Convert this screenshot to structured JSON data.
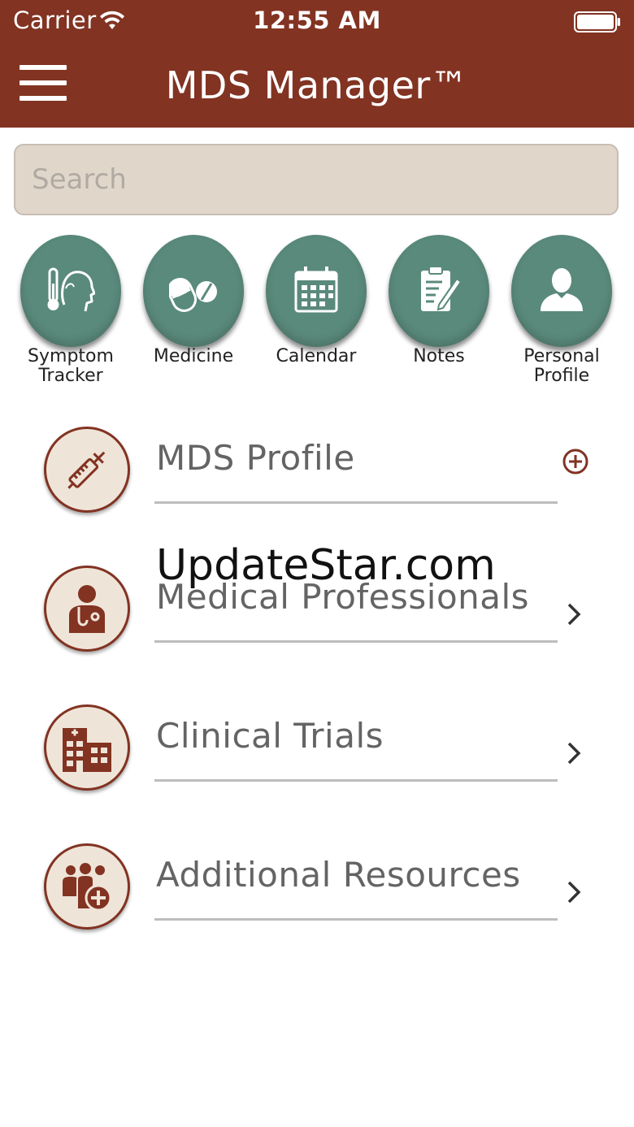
{
  "status_bar": {
    "carrier": "Carrier",
    "time": "12:55 AM"
  },
  "header": {
    "title": "MDS Manager™",
    "background_color": "#823322"
  },
  "search": {
    "placeholder": "Search",
    "value": ""
  },
  "quick_actions": [
    {
      "label": "Symptom\nTracker",
      "icon": "symptom-tracker-icon"
    },
    {
      "label": "Medicine",
      "icon": "pills-icon"
    },
    {
      "label": "Calendar",
      "icon": "calendar-icon"
    },
    {
      "label": "Notes",
      "icon": "notes-icon"
    },
    {
      "label": "Personal\nProfile",
      "icon": "person-icon"
    }
  ],
  "menu_items": [
    {
      "label": "MDS Profile",
      "icon": "syringe-icon",
      "action": "plus-circle-icon"
    },
    {
      "label": "Medical Professionals",
      "icon": "doctor-icon",
      "action": "chevron-right-icon"
    },
    {
      "label": "Clinical Trials",
      "icon": "hospital-icon",
      "action": "chevron-right-icon"
    },
    {
      "label": "Additional Resources",
      "icon": "group-add-icon",
      "action": "chevron-right-icon"
    }
  ],
  "watermark": "UpdateStar.com",
  "colors": {
    "accent": "#823322",
    "teal": "#5a8a7c",
    "badge_bg": "#efe4d8",
    "search_bg": "#e1d6ca"
  }
}
